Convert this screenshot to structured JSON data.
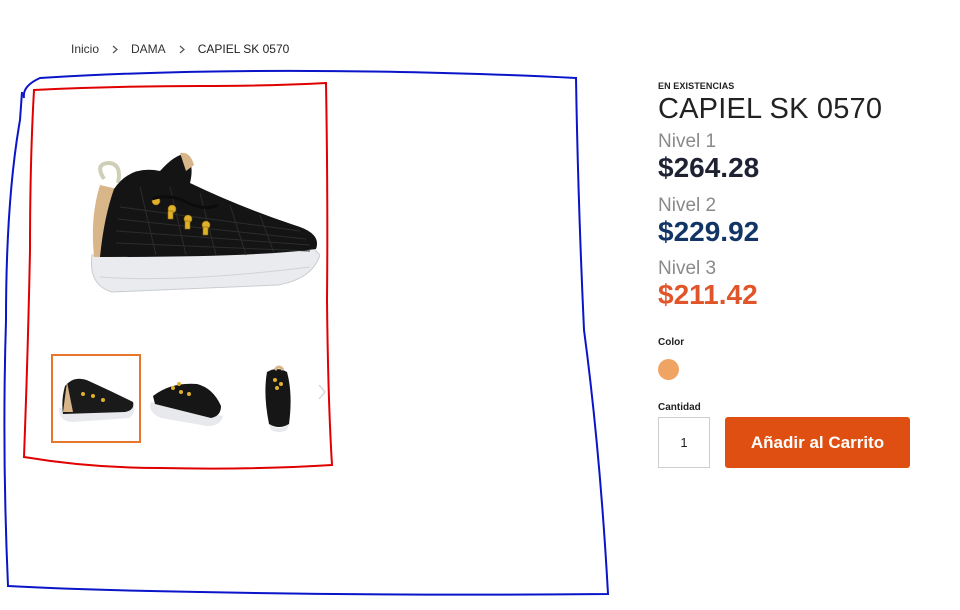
{
  "breadcrumb": {
    "items": [
      "Inicio",
      "DAMA",
      "CAPIEL SK 0570"
    ]
  },
  "product": {
    "stock_status": "EN EXISTENCIAS",
    "title": "CAPIEL SK 0570",
    "tiers": [
      {
        "name": "Nivel 1",
        "price": "$264.28",
        "color": "#1f2233"
      },
      {
        "name": "Nivel 2",
        "price": "$229.92",
        "color": "#123566"
      },
      {
        "name": "Nivel 3",
        "price": "$211.42",
        "color": "#e0562a"
      }
    ],
    "color_label": "Color",
    "color_swatch": "#f0a463",
    "quantity_label": "Cantidad",
    "quantity_value": "1",
    "add_to_cart_label": "Añadir al Carrito"
  },
  "gallery": {
    "thumbnail_count": 3,
    "active_thumbnail": 1
  },
  "colors": {
    "accent": "#e04f12",
    "active_thumb_border": "#e8762d",
    "annotation_red": "#e00000",
    "annotation_blue": "#0a14c8"
  },
  "icons": [
    "chevron-right-icon",
    "chevron-right-icon",
    "chevron-right-icon"
  ]
}
